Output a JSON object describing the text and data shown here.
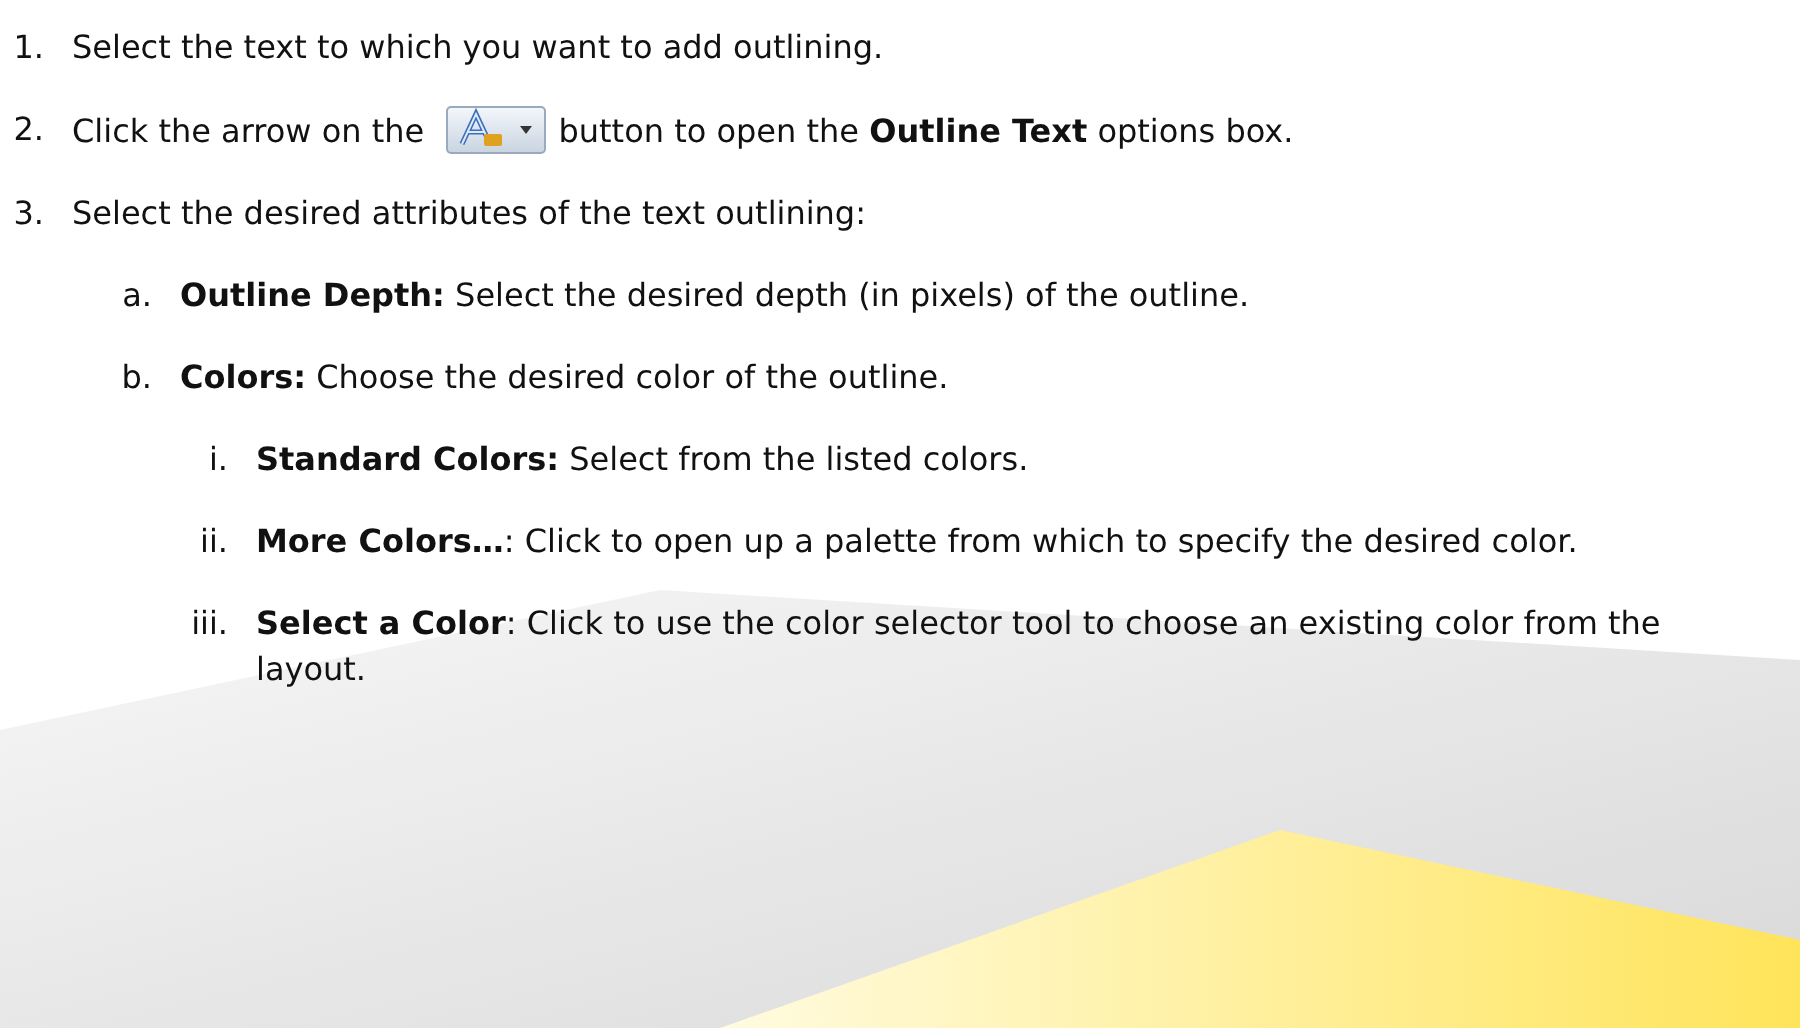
{
  "steps": [
    {
      "marker": "1.",
      "segments": [
        {
          "kind": "text",
          "text": "Select the text to which you want to add outlining."
        }
      ]
    },
    {
      "marker": "2.",
      "segments": [
        {
          "kind": "text",
          "text": "Click the arrow on the"
        },
        {
          "kind": "toolbar-button"
        },
        {
          "kind": "text",
          "text": "button to open the **Outline Text** options box."
        }
      ]
    },
    {
      "marker": "3.",
      "segments": [
        {
          "kind": "text",
          "text": "Select the desired attributes of the text outlining:"
        }
      ],
      "children": [
        {
          "marker": "a.",
          "segments": [
            {
              "kind": "text",
              "text": "**Outline Depth:** Select the desired depth (in pixels) of the outline."
            }
          ]
        },
        {
          "marker": "b.",
          "segments": [
            {
              "kind": "text",
              "text": "**Colors:** Choose the desired color of the outline."
            }
          ],
          "children": [
            {
              "marker": "i.",
              "segments": [
                {
                  "kind": "text",
                  "text": "**Standard Colors:** Select from the listed colors."
                }
              ]
            },
            {
              "marker": "ii.",
              "segments": [
                {
                  "kind": "text",
                  "text": "**More Colors…**: Click to open up a palette from which to specify the desired color."
                }
              ]
            },
            {
              "marker": "iii.",
              "segments": [
                {
                  "kind": "text",
                  "text": "**Select a Color**: Click to use the color selector tool to choose an existing color from the layout."
                }
              ]
            }
          ]
        }
      ]
    }
  ]
}
